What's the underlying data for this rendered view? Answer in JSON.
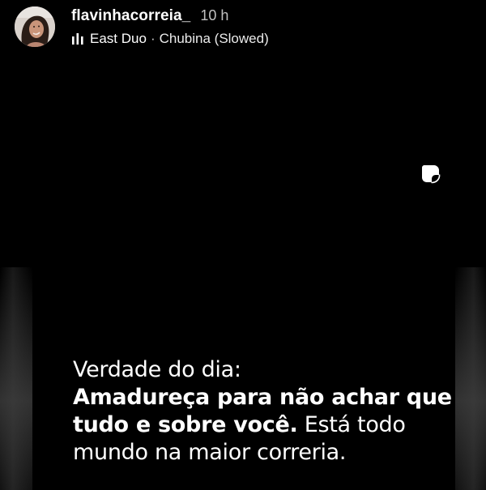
{
  "profile": {
    "username": "flavinhacorreia_",
    "time_ago": "10 h"
  },
  "music": {
    "icon": "equalizer-bars-icon",
    "artist": "East Duo",
    "separator": "·",
    "song": "Chubina (Slowed)"
  },
  "sticker": {
    "icon": "sticker-icon"
  },
  "caption": {
    "line1": "Verdade do dia:",
    "bold_part": "Amadureça para não achar que tudo e sobre você.",
    "rest": " Está todo mundo na maior correria."
  },
  "colors": {
    "background": "#000000",
    "text": "#ffffff"
  }
}
